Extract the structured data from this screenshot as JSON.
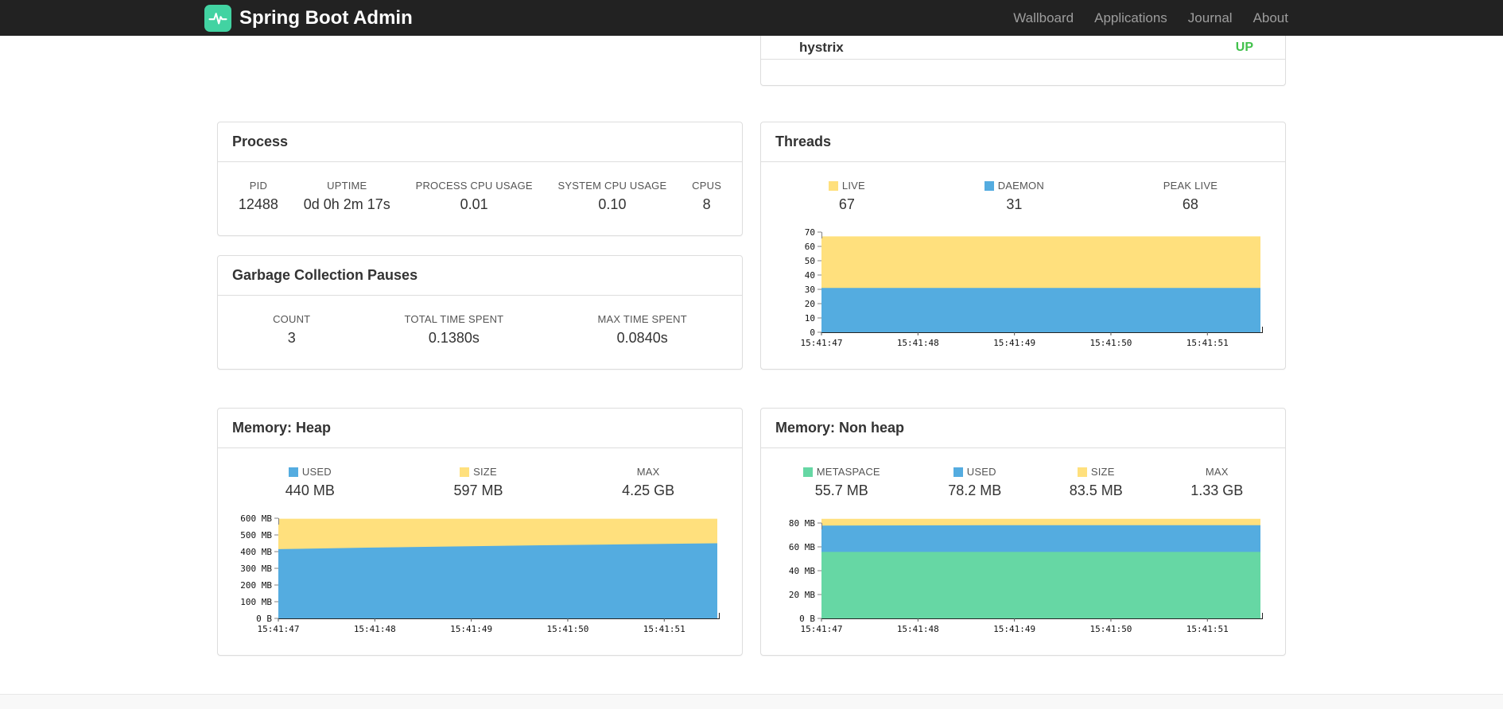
{
  "colors": {
    "navbar_bg": "#222222",
    "brand_logo": "#42d3a2",
    "status_up": "#42c14c",
    "series_yellow": "#ffe07d",
    "series_blue": "#54ace0",
    "series_green": "#66d7a4",
    "panel_border": "#dddddd"
  },
  "navbar": {
    "brand": "Spring Boot Admin",
    "items": [
      {
        "label": "Wallboard"
      },
      {
        "label": "Applications"
      },
      {
        "label": "Journal"
      },
      {
        "label": "About"
      }
    ]
  },
  "status_panel": {
    "row": {
      "name": "hystrix",
      "status": "UP"
    }
  },
  "panels": {
    "process": {
      "title": "Process",
      "metrics": [
        {
          "label": "PID",
          "value": "12488"
        },
        {
          "label": "UPTIME",
          "value": "0d 0h 2m 17s"
        },
        {
          "label": "PROCESS CPU USAGE",
          "value": "0.01"
        },
        {
          "label": "SYSTEM CPU USAGE",
          "value": "0.10"
        },
        {
          "label": "CPUS",
          "value": "8"
        }
      ]
    },
    "gc": {
      "title": "Garbage Collection Pauses",
      "metrics": [
        {
          "label": "COUNT",
          "value": "3"
        },
        {
          "label": "TOTAL TIME SPENT",
          "value": "0.1380s"
        },
        {
          "label": "MAX TIME SPENT",
          "value": "0.0840s"
        }
      ]
    },
    "threads": {
      "title": "Threads",
      "legend": [
        {
          "label": "LIVE",
          "value": "67",
          "swatch": "series_yellow"
        },
        {
          "label": "DAEMON",
          "value": "31",
          "swatch": "series_blue"
        },
        {
          "label": "PEAK LIVE",
          "value": "68",
          "swatch": null
        }
      ]
    },
    "memory_heap": {
      "title": "Memory: Heap",
      "legend": [
        {
          "label": "USED",
          "value": "440 MB",
          "swatch": "series_blue"
        },
        {
          "label": "SIZE",
          "value": "597 MB",
          "swatch": "series_yellow"
        },
        {
          "label": "MAX",
          "value": "4.25 GB",
          "swatch": null
        }
      ]
    },
    "memory_nonheap": {
      "title": "Memory: Non heap",
      "legend": [
        {
          "label": "METASPACE",
          "value": "55.7 MB",
          "swatch": "series_green"
        },
        {
          "label": "USED",
          "value": "78.2 MB",
          "swatch": "series_blue"
        },
        {
          "label": "SIZE",
          "value": "83.5 MB",
          "swatch": "series_yellow"
        },
        {
          "label": "MAX",
          "value": "1.33 GB",
          "swatch": null
        }
      ]
    }
  },
  "chart_data": [
    {
      "id": "threads",
      "type": "area",
      "stacked": true,
      "title": "Threads",
      "x_tick_labels": [
        "15:41:47",
        "15:41:48",
        "15:41:49",
        "15:41:50",
        "15:41:51"
      ],
      "x_overhang": 0.55,
      "ylim": [
        0,
        70
      ],
      "y_ticks": [
        {
          "value": 70,
          "label": "70"
        },
        {
          "value": 60,
          "label": "60"
        },
        {
          "value": 50,
          "label": "50"
        },
        {
          "value": 40,
          "label": "40"
        },
        {
          "value": 30,
          "label": "30"
        },
        {
          "value": 20,
          "label": "20"
        },
        {
          "value": 10,
          "label": "10"
        },
        {
          "value": 0,
          "label": "0"
        }
      ],
      "series": [
        {
          "name": "LIVE",
          "color": "series_yellow",
          "values": [
            67,
            67,
            67,
            67,
            67,
            67
          ]
        },
        {
          "name": "DAEMON",
          "color": "series_blue",
          "values": [
            31,
            31,
            31,
            31,
            31,
            31
          ]
        }
      ]
    },
    {
      "id": "memory-heap",
      "type": "area",
      "stacked": true,
      "title": "Memory: Heap",
      "x_tick_labels": [
        "15:41:47",
        "15:41:48",
        "15:41:49",
        "15:41:50",
        "15:41:51"
      ],
      "x_overhang": 0.55,
      "ylim": [
        0,
        600
      ],
      "y_ticks": [
        {
          "value": 600,
          "label": "600 MB"
        },
        {
          "value": 500,
          "label": "500 MB"
        },
        {
          "value": 400,
          "label": "400 MB"
        },
        {
          "value": 300,
          "label": "300 MB"
        },
        {
          "value": 200,
          "label": "200 MB"
        },
        {
          "value": 100,
          "label": "100 MB"
        },
        {
          "value": 0,
          "label": "0 B"
        }
      ],
      "series": [
        {
          "name": "SIZE",
          "color": "series_yellow",
          "values": [
            597,
            597,
            597,
            597,
            597,
            597
          ]
        },
        {
          "name": "USED",
          "color": "series_blue",
          "values": [
            415,
            424,
            431,
            438,
            444,
            450
          ]
        }
      ]
    },
    {
      "id": "memory-nonheap",
      "type": "area",
      "stacked": true,
      "title": "Memory: Non heap",
      "x_tick_labels": [
        "15:41:47",
        "15:41:48",
        "15:41:49",
        "15:41:50",
        "15:41:51"
      ],
      "x_overhang": 0.55,
      "ylim": [
        0,
        84
      ],
      "y_ticks": [
        {
          "value": 80,
          "label": "80 MB"
        },
        {
          "value": 60,
          "label": "60 MB"
        },
        {
          "value": 40,
          "label": "40 MB"
        },
        {
          "value": 20,
          "label": "20 MB"
        },
        {
          "value": 0,
          "label": "0 B"
        }
      ],
      "series": [
        {
          "name": "SIZE",
          "color": "series_yellow",
          "values": [
            83.5,
            83.5,
            83.5,
            83.5,
            83.5,
            83.5
          ]
        },
        {
          "name": "USED",
          "color": "series_blue",
          "values": [
            77.8,
            78.0,
            78.2,
            78.2,
            78.2,
            78.2
          ]
        },
        {
          "name": "METASPACE",
          "color": "series_green",
          "values": [
            55.7,
            55.7,
            55.7,
            55.7,
            55.7,
            55.7
          ]
        }
      ]
    }
  ]
}
